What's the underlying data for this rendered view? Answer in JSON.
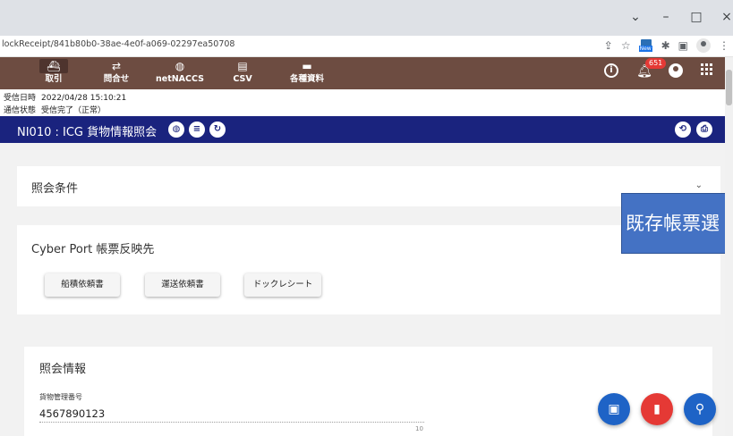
{
  "window": {
    "minimize": "–",
    "maximize": "□",
    "close": "×",
    "dropdown": "⌄"
  },
  "browser": {
    "url": "lockReceipt/841b80b0-38ae-4e0f-a069-02297ea50708"
  },
  "nav": {
    "items": [
      {
        "label": "取引",
        "icon": "ship-icon"
      },
      {
        "label": "問合せ",
        "icon": "swap-arrows-icon"
      },
      {
        "label": "netNACCS",
        "icon": "globe-icon"
      },
      {
        "label": "CSV",
        "icon": "file-export-icon"
      },
      {
        "label": "各種資料",
        "icon": "folder-icon"
      }
    ],
    "notification_count": "651"
  },
  "receipt": {
    "date_label": "受信日時",
    "date_value": "2022/04/28 15:10:21",
    "status_label": "通信状態",
    "status_value": "受信完了（正常）"
  },
  "page": {
    "title": "NI010 : ICG 貨物情報照会"
  },
  "sections": {
    "conditions": "照会条件",
    "cyberport": "Cyber Port 帳票反映先",
    "info": "照会情報"
  },
  "buttons": {
    "ship_request": "船積依頼書",
    "transport_request": "運送依頼書",
    "dock_receipt": "ドックレシート"
  },
  "banner": {
    "text": "既存帳票選"
  },
  "field": {
    "label": "貨物管理番号",
    "value": "4567890123",
    "counter": "10"
  },
  "colors": {
    "nav_bg": "#6d4c41",
    "title_bg": "#1a237e",
    "fab_blue": "#1e63c6",
    "fab_red": "#e53935",
    "banner": "#4472c4"
  }
}
